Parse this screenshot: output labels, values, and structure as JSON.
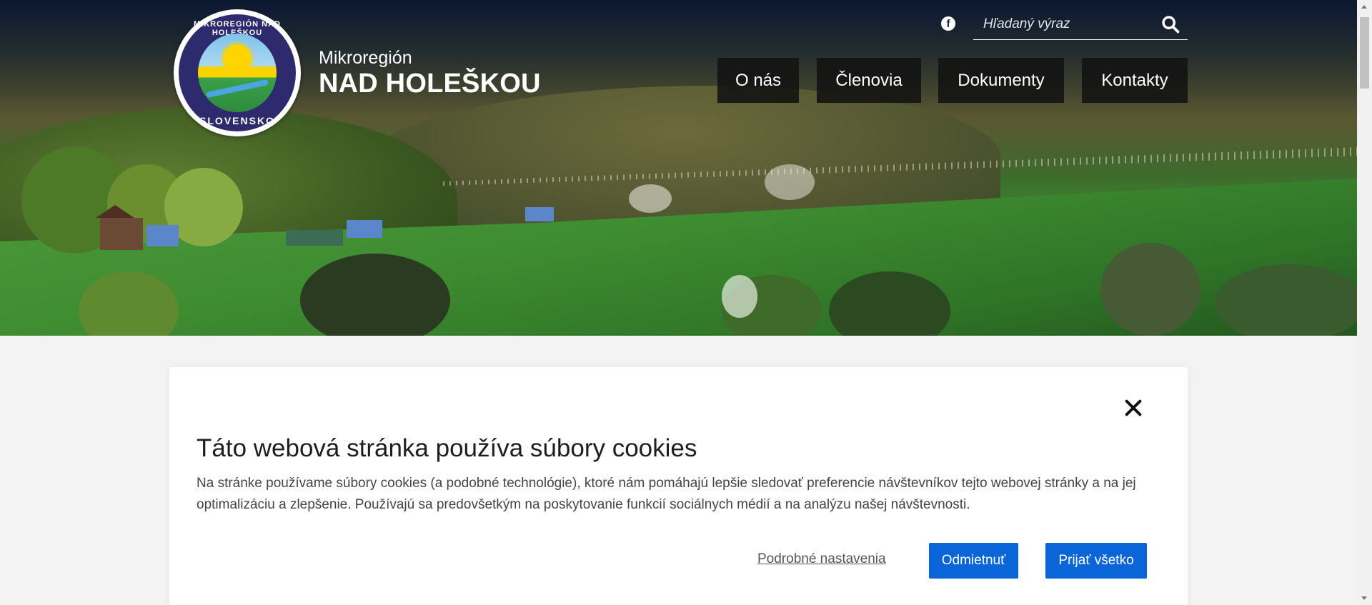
{
  "header": {
    "logo": {
      "text_top": "MIKROREGIÓN NAD HOLEŠKOU",
      "text_bottom": "SLOVENSKO"
    },
    "brand_sub": "Mikroregión",
    "brand_main": "NAD HOLEŠKOU",
    "social_icon": "facebook-icon",
    "search": {
      "placeholder": "Hľadaný výraz",
      "icon": "search-icon"
    },
    "nav": [
      "O nás",
      "Členovia",
      "Dokumenty",
      "Kontakty"
    ]
  },
  "cookie_banner": {
    "title": "Táto webová stránka používa súbory cookies",
    "text": "Na stránke používame súbory cookies (a podobné technológie), ktoré nám pomáhajú lepšie sledovať preferencie návštevníkov tejto webovej stránky a na jej optimalizáciu a zlepšenie. Používajú sa predovšetkým na poskytovanie funkcií sociálnych médií a na analýzu našej návštevnosti.",
    "link_details": "Podrobné nastavenia",
    "btn_reject": "Odmietnuť",
    "btn_accept": "Prijať všetko",
    "close_icon": "close-icon"
  },
  "colors": {
    "accent": "#0a66d8",
    "nav_bg": "#121212",
    "header_overlay": "#0a1634"
  }
}
